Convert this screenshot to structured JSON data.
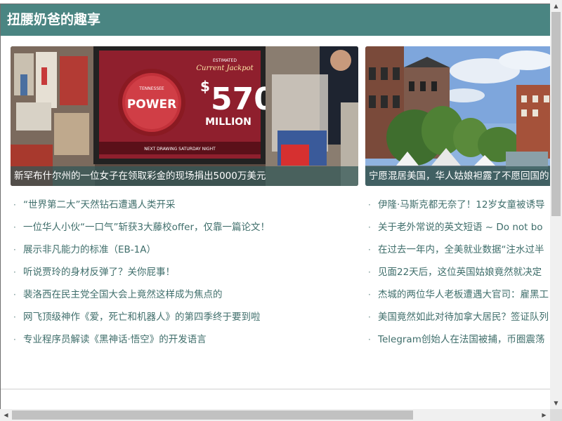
{
  "header": {
    "title": "扭腰奶爸的趣享"
  },
  "featured": [
    {
      "caption": "新罕布什尔州的一位女子在领取彩金的现场捐出5000万美元",
      "image_text": {
        "jackpot_line1": "ESTIMATED",
        "jackpot_line2": "Current Jackpot",
        "amount": "570",
        "dollar": "$",
        "unit": "MILLION",
        "brand": "POWER",
        "brand_small": "TENNESSEE",
        "ticker": "NEXT DRAWING SATURDAY NIGHT"
      }
    },
    {
      "caption": "宁愿混居美国，华人姑娘袒露了不愿回国的"
    }
  ],
  "list_left": [
    "“世界第二大”天然钻石遭遇人类开采",
    "一位华人小伙“一口气”斩获3大藤校offer，仅靠一篇论文！",
    "展示非凡能力的标准（EB-1A）",
    "听说贾玲的身材反弹了？关你屁事！",
    "裴洛西在民主党全国大会上竟然这样成为焦点的",
    "网飞顶级神作《爱，死亡和机器人》的第四季终于要到啦",
    "专业程序员解读《黑神话·悟空》的开发语言"
  ],
  "list_right": [
    "伊隆·马斯克都无奈了！12岁女童被诱导",
    "关于老外常说的英文短语 ~ Do not bo",
    "在过去一年内，全美就业数据“注水过半",
    "见面22天后，这位英国姑娘竟然就决定",
    "杰城的两位华人老板遭遇大官司：雇黑工",
    "美国竟然如此对待加拿大居民？签证队列",
    "Telegram创始人在法国被捕，币圈震荡"
  ],
  "bullet_char": "·",
  "scrollbar": {
    "up_arrow": "▲",
    "down_arrow": "▼",
    "left_arrow": "◀",
    "right_arrow": "▶"
  },
  "colors": {
    "header_bg": "#4a8582",
    "link_text": "#3f6e6b",
    "caption_overlay": "#305656"
  }
}
